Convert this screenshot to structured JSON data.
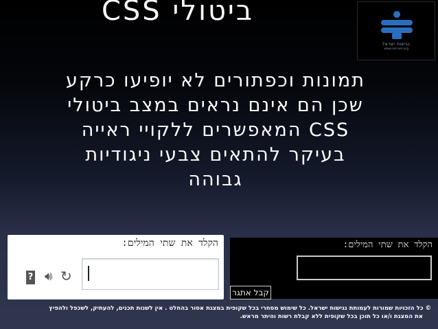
{
  "slide": {
    "title": "ביטולי CSS",
    "body_lines": [
      "תמונות וכפתורים לא יופיעו כרקע",
      "שכן הם אינם נראים במצב ביטולי",
      "CSS המאפשרים ללקויי ראייה",
      "בעיקר להתאים צבעי ניגודיות",
      "גבוהה"
    ]
  },
  "captcha_normal": {
    "label": "הקלד את שתי המילים:",
    "icons": [
      "help-icon",
      "audio-icon",
      "refresh-icon"
    ]
  },
  "captcha_no_css": {
    "label": "הקלד את שתי המילים:",
    "button_label": "קבל אתגר"
  },
  "footer": {
    "line1": "כל הזכויות שמורות לעמותת נגישות ישראל. כל שימוש מסחרי בכל שקופית במצגת אסור בהחלט . אין לשנות תכנים, להעתיק, לשכפל ולהפיץ",
    "line2": "את המצגת ו/או כל תוכן בכל שקופית ללא קבלת רשות והיתר מראש."
  },
  "logo": {
    "text": "נגישות ישראל",
    "url_text": "www.aisrael.org"
  },
  "colors": {
    "logo_blue": "#2a6fbf"
  }
}
